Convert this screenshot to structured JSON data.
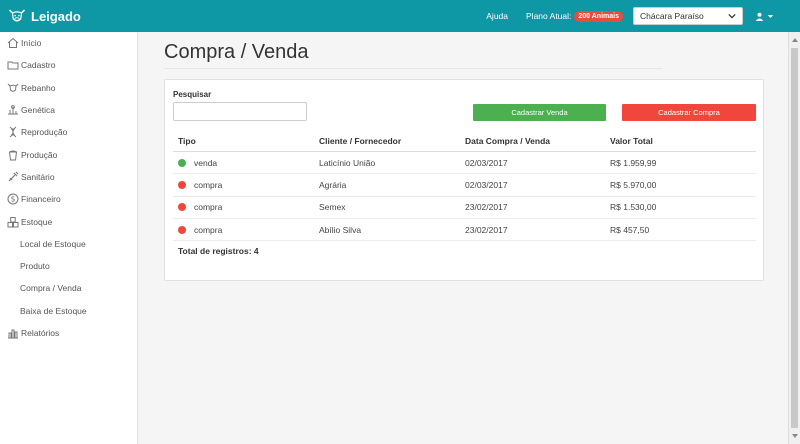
{
  "app": {
    "brand": "Leigado"
  },
  "header": {
    "help": "Ajuda",
    "plan_label": "Plano Atual:",
    "plan_badge": "200 Animais",
    "farm": "Chácara Paraíso"
  },
  "sidebar": {
    "items": [
      {
        "label": "Início",
        "icon": "home-icon"
      },
      {
        "label": "Cadastro",
        "icon": "folder-icon"
      },
      {
        "label": "Rebanho",
        "icon": "cattle-icon"
      },
      {
        "label": "Genética",
        "icon": "genetics-icon"
      },
      {
        "label": "Reprodução",
        "icon": "dna-icon"
      },
      {
        "label": "Produção",
        "icon": "milk-bucket-icon"
      },
      {
        "label": "Sanitário",
        "icon": "syringe-icon"
      },
      {
        "label": "Financeiro",
        "icon": "dollar-icon"
      },
      {
        "label": "Estoque",
        "icon": "boxes-icon"
      },
      {
        "label": "Local de Estoque"
      },
      {
        "label": "Produto"
      },
      {
        "label": "Compra / Venda"
      },
      {
        "label": "Baixa de Estoque"
      },
      {
        "label": "Relatórios",
        "icon": "bar-chart-icon"
      }
    ]
  },
  "page": {
    "title": "Compra / Venda",
    "search_label": "Pesquisar",
    "btn_sell": "Cadastrar Venda",
    "btn_buy": "Cadastrar Compra",
    "table": {
      "headers": [
        "Tipo",
        "Cliente / Fornecedor",
        "Data Compra / Venda",
        "Valor Total"
      ],
      "rows": [
        {
          "tipo": "venda",
          "cliente": "Laticínio União",
          "data": "02/03/2017",
          "valor": "R$ 1.959,99",
          "status_color": "#4caf50"
        },
        {
          "tipo": "compra",
          "cliente": "Agrária",
          "data": "02/03/2017",
          "valor": "R$ 5.970,00",
          "status_color": "#f0463c"
        },
        {
          "tipo": "compra",
          "cliente": "Semex",
          "data": "23/02/2017",
          "valor": "R$ 1.530,00",
          "status_color": "#f0463c"
        },
        {
          "tipo": "compra",
          "cliente": "Abílio Silva",
          "data": "23/02/2017",
          "valor": "R$ 457,50",
          "status_color": "#f0463c"
        }
      ]
    },
    "total": "Total de registros: 4"
  },
  "colors": {
    "accent": "#0e97a5",
    "success": "#4caf50",
    "danger": "#f0463c",
    "badge": "#e74c3c"
  }
}
